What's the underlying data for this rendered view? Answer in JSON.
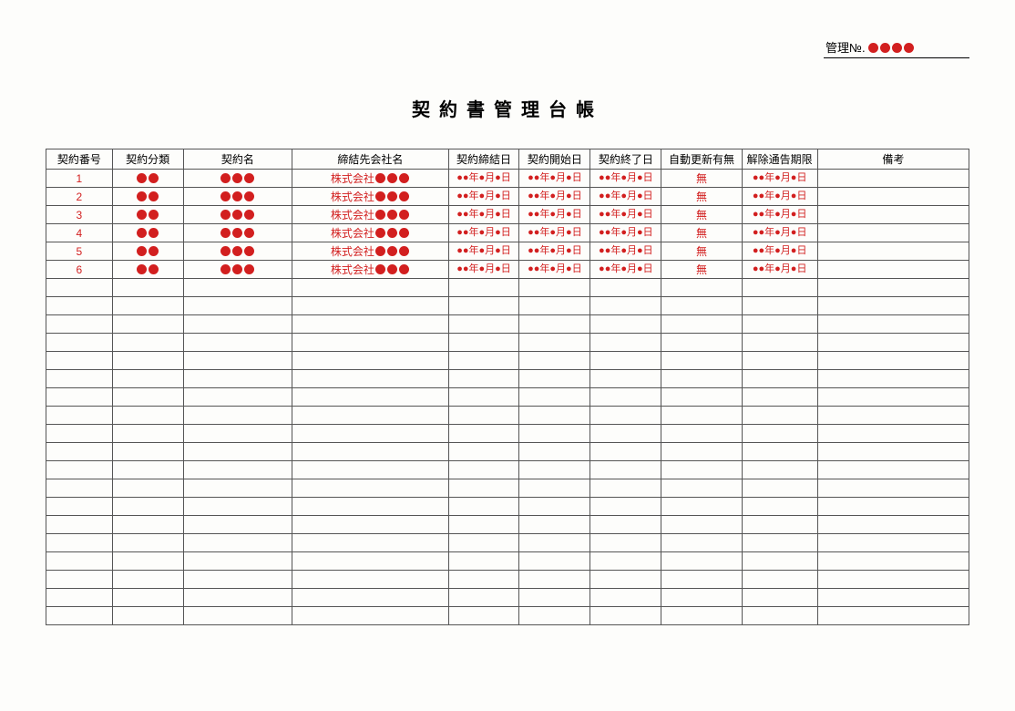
{
  "admin": {
    "label": "管理№.",
    "dot_count": 4
  },
  "title": "契約書管理台帳",
  "columns": [
    "契約番号",
    "契約分類",
    "契約名",
    "締結先会社名",
    "契約締結日",
    "契約開始日",
    "契約終了日",
    "自動更新有無",
    "解除通告期限",
    "備考"
  ],
  "rows": [
    {
      "no": "1",
      "cat_dots": 2,
      "name_dots": 3,
      "company_prefix": "株式会社",
      "company_dots": 3,
      "date1": "●●年●月●日",
      "date2": "●●年●月●日",
      "date3": "●●年●月●日",
      "auto": "無",
      "deadline": "●●年●月●日",
      "note": ""
    },
    {
      "no": "2",
      "cat_dots": 2,
      "name_dots": 3,
      "company_prefix": "株式会社",
      "company_dots": 3,
      "date1": "●●年●月●日",
      "date2": "●●年●月●日",
      "date3": "●●年●月●日",
      "auto": "無",
      "deadline": "●●年●月●日",
      "note": ""
    },
    {
      "no": "3",
      "cat_dots": 2,
      "name_dots": 3,
      "company_prefix": "株式会社",
      "company_dots": 3,
      "date1": "●●年●月●日",
      "date2": "●●年●月●日",
      "date3": "●●年●月●日",
      "auto": "無",
      "deadline": "●●年●月●日",
      "note": ""
    },
    {
      "no": "4",
      "cat_dots": 2,
      "name_dots": 3,
      "company_prefix": "株式会社",
      "company_dots": 3,
      "date1": "●●年●月●日",
      "date2": "●●年●月●日",
      "date3": "●●年●月●日",
      "auto": "無",
      "deadline": "●●年●月●日",
      "note": ""
    },
    {
      "no": "5",
      "cat_dots": 2,
      "name_dots": 3,
      "company_prefix": "株式会社",
      "company_dots": 3,
      "date1": "●●年●月●日",
      "date2": "●●年●月●日",
      "date3": "●●年●月●日",
      "auto": "無",
      "deadline": "●●年●月●日",
      "note": ""
    },
    {
      "no": "6",
      "cat_dots": 2,
      "name_dots": 3,
      "company_prefix": "株式会社",
      "company_dots": 3,
      "date1": "●●年●月●日",
      "date2": "●●年●月●日",
      "date3": "●●年●月●日",
      "auto": "無",
      "deadline": "●●年●月●日",
      "note": ""
    }
  ],
  "empty_rows": 19
}
